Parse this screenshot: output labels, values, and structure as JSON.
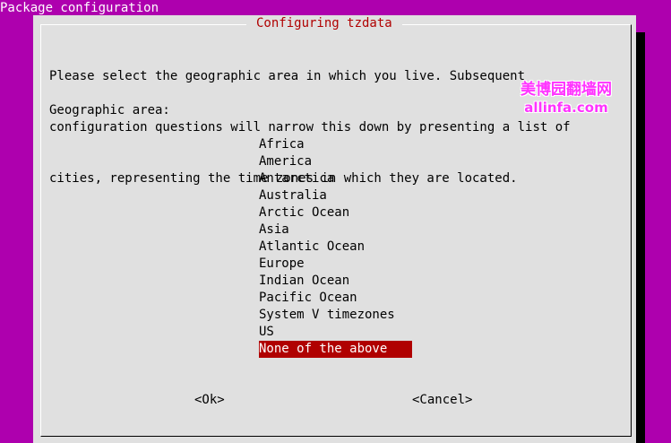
{
  "window": {
    "title": "Package configuration"
  },
  "dialog": {
    "title": "Configuring tzdata",
    "prompt_lines": [
      "Please select the geographic area in which you live. Subsequent",
      "configuration questions will narrow this down by presenting a list of",
      "cities, representing the time zones in which they are located."
    ],
    "area_label": "Geographic area:",
    "options": [
      "Africa",
      "America",
      "Antarctica",
      "Australia",
      "Arctic Ocean",
      "Asia",
      "Atlantic Ocean",
      "Europe",
      "Indian Ocean",
      "Pacific Ocean",
      "System V timezones",
      "US",
      "None of the above"
    ],
    "selected_option": "None of the above",
    "ok_label": "<Ok>",
    "cancel_label": "<Cancel>"
  },
  "watermark": {
    "line1": "美博园翻墙网",
    "line2": "allinfa.com"
  },
  "colors": {
    "background": "#ae00ae",
    "dialog": "#e0e0e0",
    "accent": "#b00000",
    "watermark": "#ff33ff"
  }
}
